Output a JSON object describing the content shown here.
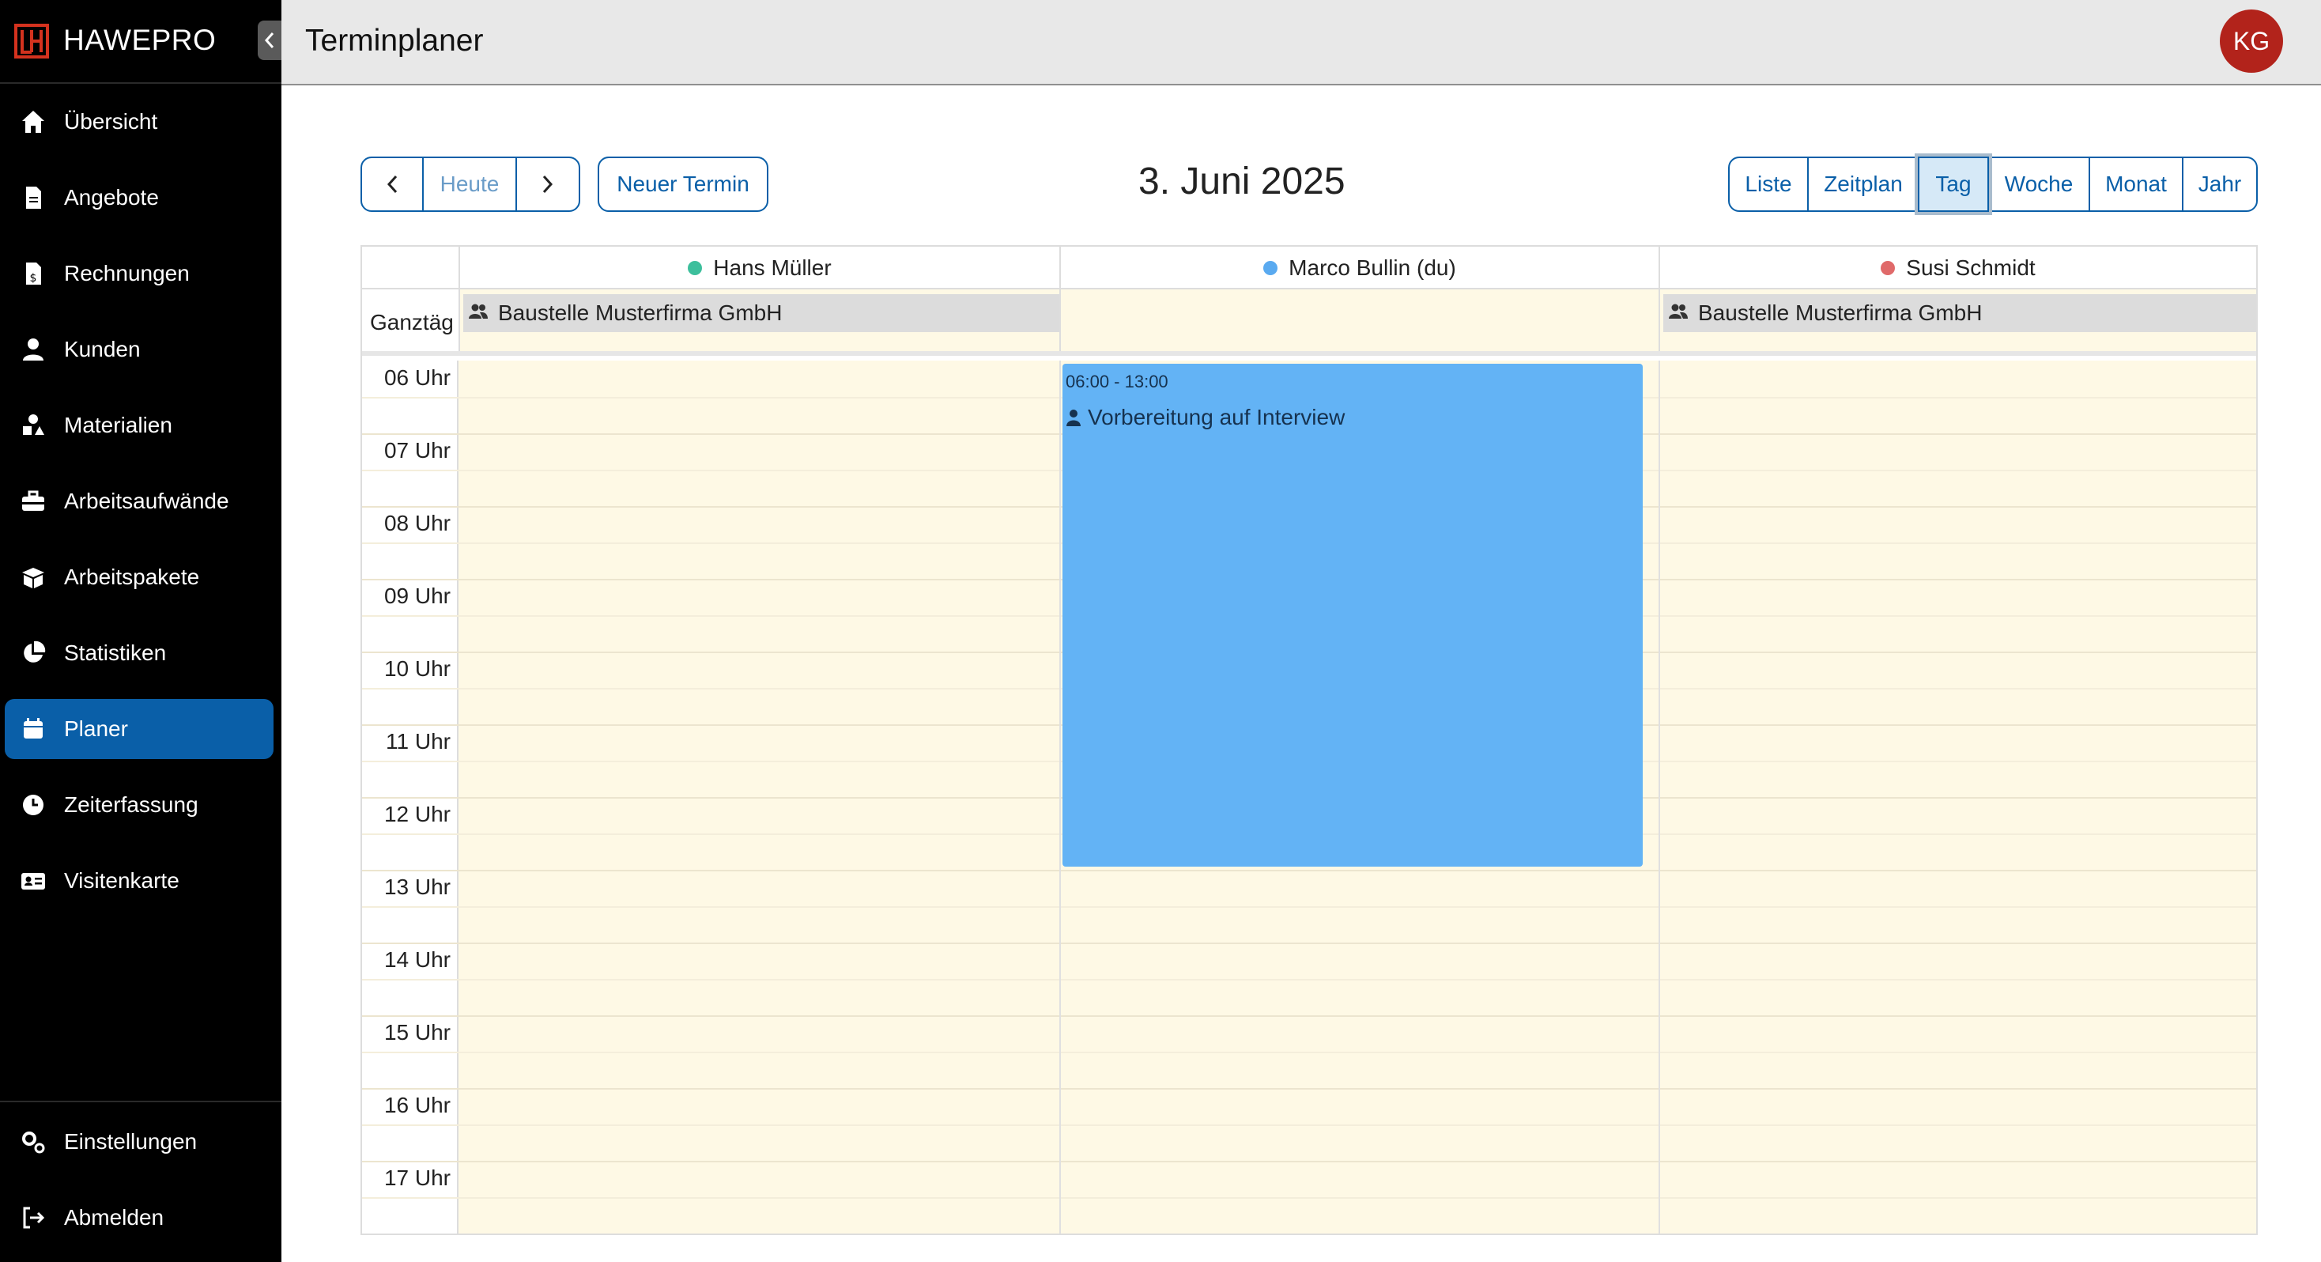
{
  "app": {
    "brand": "HAWEPRO",
    "page_title": "Terminplaner",
    "avatar_initials": "KG"
  },
  "sidebar": {
    "items": [
      {
        "label": "Übersicht",
        "icon": "home-icon"
      },
      {
        "label": "Angebote",
        "icon": "document-icon"
      },
      {
        "label": "Rechnungen",
        "icon": "invoice-icon"
      },
      {
        "label": "Kunden",
        "icon": "user-icon"
      },
      {
        "label": "Materialien",
        "icon": "shapes-icon"
      },
      {
        "label": "Arbeitsaufwände",
        "icon": "toolbox-icon"
      },
      {
        "label": "Arbeitspakete",
        "icon": "box-icon"
      },
      {
        "label": "Statistiken",
        "icon": "pie-chart-icon"
      },
      {
        "label": "Planer",
        "icon": "calendar-icon",
        "active": true
      },
      {
        "label": "Zeiterfassung",
        "icon": "clock-icon"
      },
      {
        "label": "Visitenkarte",
        "icon": "id-card-icon"
      }
    ],
    "bottom_items": [
      {
        "label": "Einstellungen",
        "icon": "gears-icon"
      },
      {
        "label": "Abmelden",
        "icon": "logout-icon"
      }
    ]
  },
  "toolbar": {
    "today": "Heute",
    "new_appointment": "Neuer Termin",
    "date_title": "3. Juni 2025",
    "views": [
      "Liste",
      "Zeitplan",
      "Tag",
      "Woche",
      "Monat",
      "Jahr"
    ],
    "active_view": "Tag"
  },
  "calendar": {
    "allday_label": "Ganztäg",
    "resources": [
      {
        "name": "Hans Müller",
        "color": "#3dbf9c"
      },
      {
        "name": "Marco Bullin (du)",
        "color": "#5aaaf0"
      },
      {
        "name": "Susi Schmidt",
        "color": "#e06a6a"
      }
    ],
    "hours": [
      "06 Uhr",
      "07 Uhr",
      "08 Uhr",
      "09 Uhr",
      "10 Uhr",
      "11 Uhr",
      "12 Uhr",
      "13 Uhr",
      "14 Uhr",
      "15 Uhr",
      "16 Uhr",
      "17 Uhr"
    ],
    "allday_events": [
      {
        "resource": 0,
        "title": "Baustelle Musterfirma GmbH",
        "icon": "users-icon"
      },
      {
        "resource": 2,
        "title": "Baustelle Musterfirma GmbH",
        "icon": "users-icon"
      }
    ],
    "events": [
      {
        "resource": 1,
        "start": "06:00",
        "end": "13:00",
        "time_label": "06:00 - 13:00",
        "title": "Vorbereitung auf Interview",
        "icon": "user-icon",
        "color": "#63b3f5"
      }
    ]
  }
}
